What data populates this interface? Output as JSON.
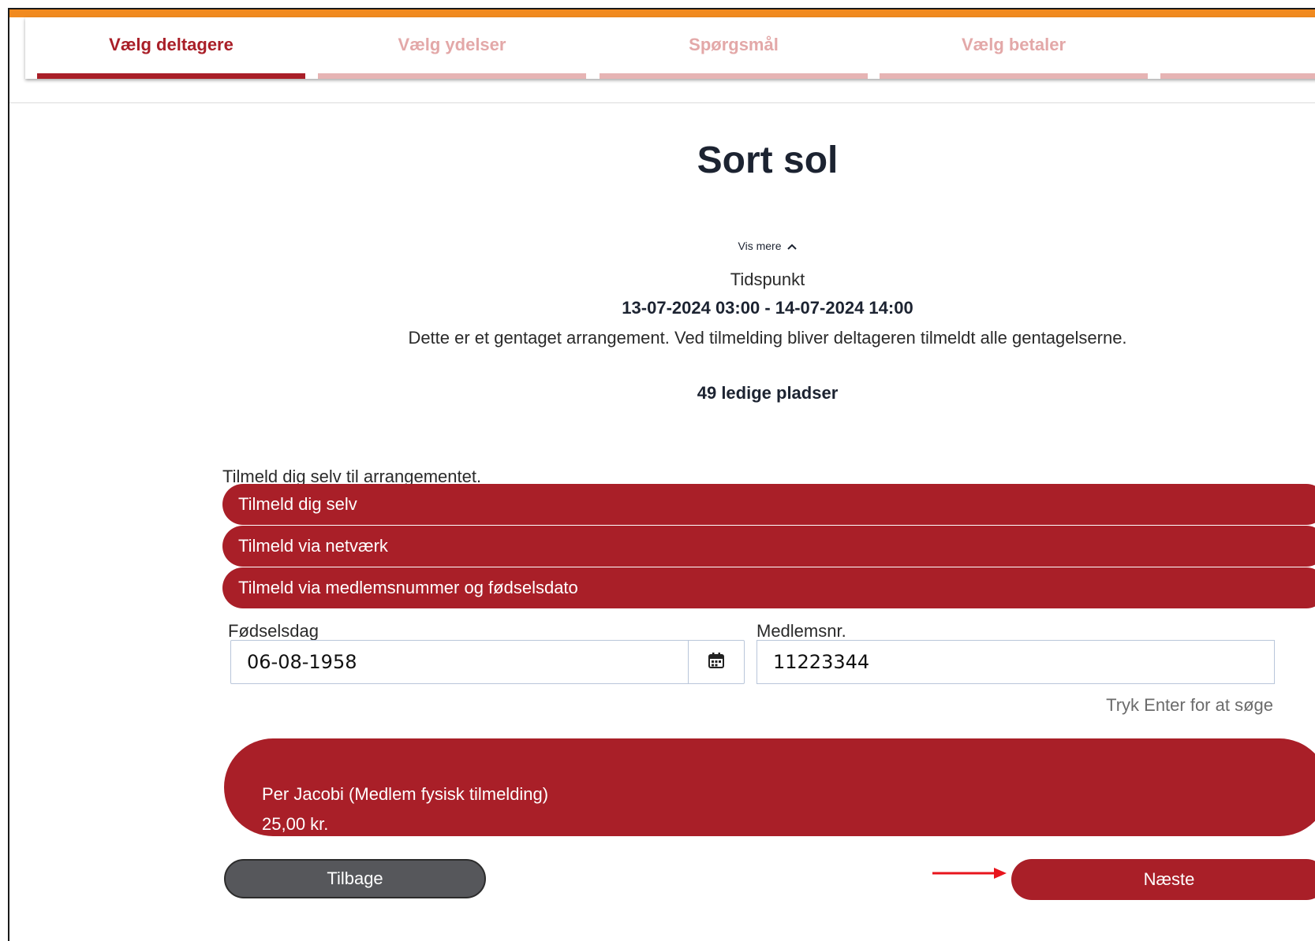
{
  "stepper": {
    "steps": [
      {
        "label": "Vælg deltagere",
        "active": true
      },
      {
        "label": "Vælg ydelser",
        "active": false
      },
      {
        "label": "Spørgsmål",
        "active": false
      },
      {
        "label": "Vælg betaler",
        "active": false
      },
      {
        "label": "",
        "active": false
      }
    ]
  },
  "event": {
    "title": "Sort sol",
    "vis_mere": "Vis mere",
    "tidspunkt_label": "Tidspunkt",
    "tidspunkt_value": "13-07-2024 03:00 - 14-07-2024 14:00",
    "repeat_note": "Dette er et gentaget arrangement. Ved tilmelding bliver deltageren tilmeldt alle gentagelserne.",
    "seats": "49 ledige pladser"
  },
  "registration": {
    "section_label": "Tilmeld dig selv til arrangementet.",
    "options": [
      "Tilmeld dig selv",
      "Tilmeld via netværk",
      "Tilmeld via medlemsnummer og fødselsdato"
    ],
    "birthday_label": "Fødselsdag",
    "birthday_value": "06-08-1958",
    "member_label": "Medlemsnr.",
    "member_value": "11223344",
    "search_hint": "Tryk Enter for at søge"
  },
  "participant": {
    "name": "Per Jacobi (Medlem fysisk tilmelding)",
    "price": "25,00 kr."
  },
  "nav": {
    "back_label": "Tilbage",
    "next_label": "Næste"
  },
  "colors": {
    "accent": "#a91f28",
    "accent_light": "#e6b4b4",
    "top_bar": "#f18a1f",
    "back_button": "#56575b",
    "annotation_arrow": "#e8141c"
  },
  "icons": {
    "calendar": "calendar-icon",
    "chevron": "chevron-up-icon",
    "annotation": "red-arrow-icon"
  }
}
